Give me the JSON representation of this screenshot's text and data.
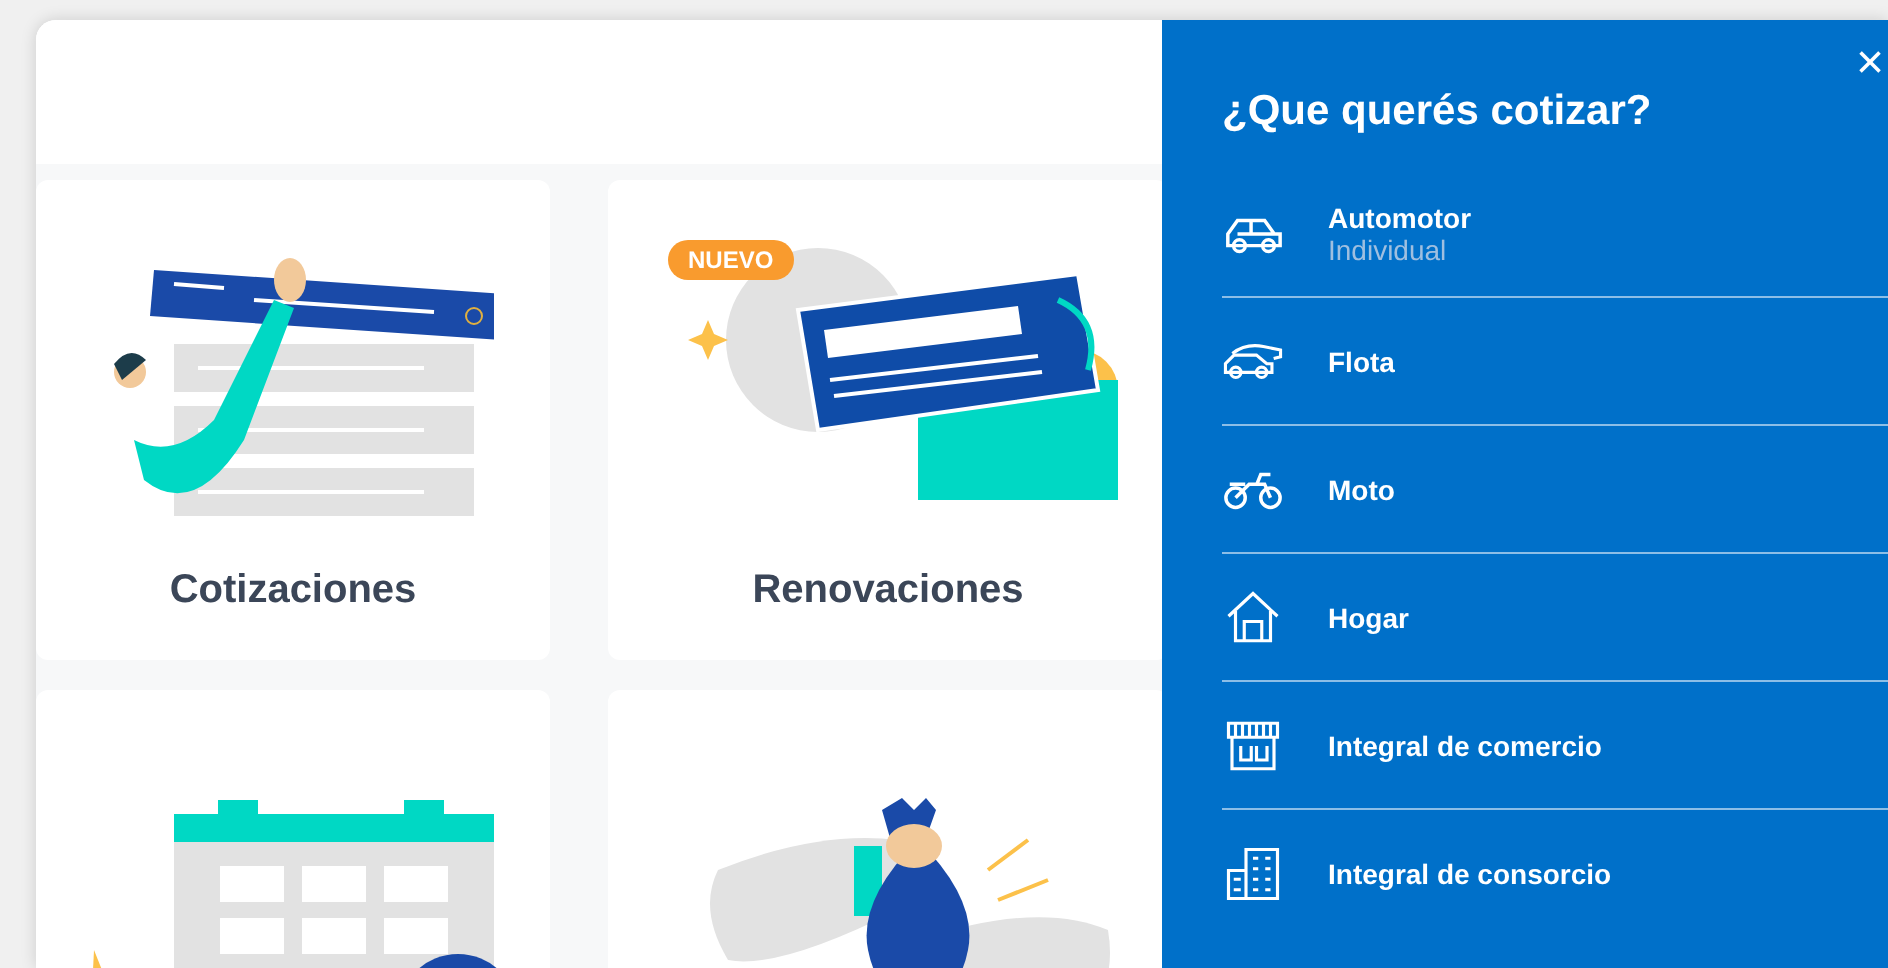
{
  "cards": [
    {
      "title": "Cotizaciones"
    },
    {
      "title": "Renovaciones",
      "badge": "NUEVO"
    }
  ],
  "panel": {
    "close": "×",
    "title": "¿Que querés cotizar?",
    "items": [
      {
        "label": "Automotor",
        "sublabel": "Individual"
      },
      {
        "label": "Flota"
      },
      {
        "label": "Moto"
      },
      {
        "label": "Hogar"
      },
      {
        "label": "Integral de comercio"
      },
      {
        "label": "Integral de consorcio"
      }
    ]
  }
}
